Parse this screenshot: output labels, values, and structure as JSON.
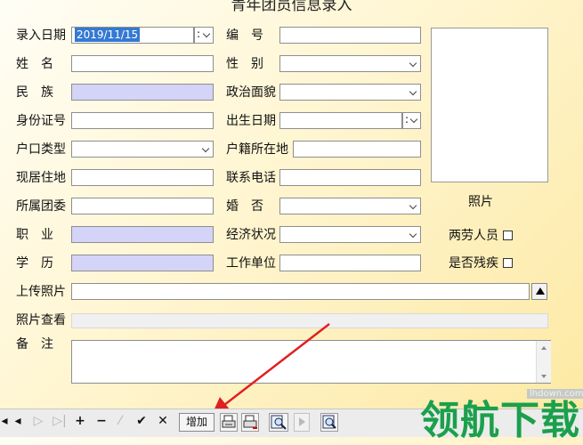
{
  "window": {
    "title": "青年团员信息录入"
  },
  "form": {
    "entry_date_label": "录入日期",
    "entry_date_value": "2019/11/15",
    "number_label": "编　号",
    "name_label": "姓　名",
    "gender_label": "性　别",
    "ethnicity_label": "民　族",
    "political_label": "政治面貌",
    "id_label": "身份证号",
    "birth_label": "出生日期",
    "hukou_type_label": "户口类型",
    "hukou_place_label": "户籍所在地",
    "address_label": "现居住地",
    "phone_label": "联系电话",
    "league_label": "所属团委",
    "marital_label": "婚　否",
    "job_label": "职　业",
    "economic_label": "经济状况",
    "edu_label": "学　历",
    "workplace_label": "工作单位",
    "upload_label": "上传照片",
    "view_label": "照片查看",
    "remarks_label": "备　注"
  },
  "photo": {
    "caption": "照片"
  },
  "flags": {
    "two_labor_label": "两劳人员",
    "disabled_label": "是否残疾"
  },
  "toolbar": {
    "first": "◂",
    "prev": "◂",
    "next": "▷",
    "last": "▷|",
    "add_icon": "+",
    "remove_icon": "−",
    "edit_icon": "⁄",
    "confirm_icon": "✔",
    "cancel_icon": "✕",
    "add_button": "增加"
  },
  "watermark": {
    "brand": "领航下载",
    "url": "lhdown.com"
  },
  "colors": {
    "annotation_arrow": "#e02020",
    "brand_green": "#1ba04c"
  }
}
